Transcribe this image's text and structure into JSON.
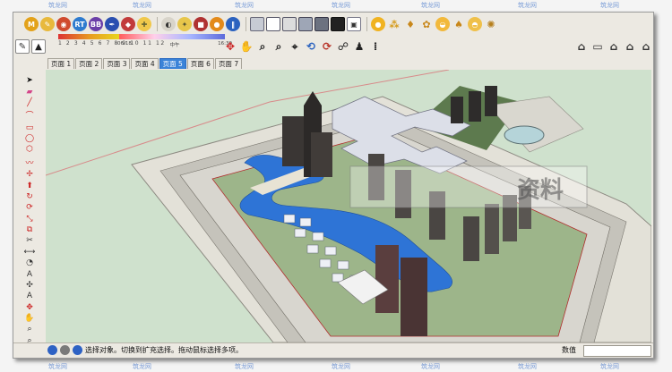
{
  "scene_tabs": [
    "页面 1",
    "页面 2",
    "页面 3",
    "页面 4",
    "页面 5",
    "页面 6",
    "页面 7"
  ],
  "active_tab_index": 4,
  "shadow_slider": {
    "ticks": "1 2 3 4 5 6 7 8 9 10 11 12",
    "time_start": "06:18",
    "time_mid": "中午",
    "time_end": "16:30"
  },
  "status": {
    "message": "选择对象。切换到扩充选择。拖动鼠标选择多项。",
    "measure_label": "数值",
    "measure_value": ""
  },
  "watermark": {
    "text": "筑龙网",
    "overlay_text": "资料"
  },
  "colors": {
    "accent": "#3b83d8",
    "ground": "#cfe1cd",
    "water": "#2e74d6",
    "toolbar_bg": "#ece9e2"
  },
  "toolbar_top_icons": [
    "get-models-icon",
    "share-model-icon",
    "layer-icon",
    "rt-icon",
    "bb-icon",
    "pen-icon",
    "dimension-icon",
    "protractor-icon",
    "section-icon",
    "axes-icon",
    "sandbox-icon",
    "follow-icon",
    "flip-icon",
    "cube-face-icon",
    "cube-wire-icon",
    "cube-shaded-icon",
    "cube-texture-icon",
    "cube-monochrome-icon",
    "cube-xray-icon",
    "shadow-sun-icon",
    "fog-icon",
    "edge-style-icon",
    "camera-position-icon",
    "walk-icon",
    "position-camera-icon",
    "look-around-icon"
  ],
  "toolbar_second_icons": [
    "select-tool-icon",
    "eraser-icon",
    "paint-bucket-icon",
    "orbit-icon",
    "pan-icon",
    "zoom-icon",
    "zoom-window-icon",
    "zoom-extents-icon",
    "previous-view-icon",
    "next-view-icon",
    "position-camera-icon",
    "walk-icon",
    "look-around-icon"
  ],
  "toolbar_right_icons": [
    "iso-view-icon",
    "top-view-icon",
    "front-view-icon",
    "right-view-icon",
    "back-view-icon",
    "left-view-icon"
  ],
  "left_toolbar_icons": [
    "select-icon",
    "eraser-icon",
    "line-icon",
    "arc-icon",
    "rectangle-icon",
    "circle-icon",
    "polygon-icon",
    "freehand-icon",
    "move-icon",
    "push-pull-icon",
    "rotate-icon",
    "follow-me-icon",
    "scale-icon",
    "offset-icon",
    "tape-measure-icon",
    "dimension-icon",
    "protractor-icon",
    "text-icon",
    "axes-icon",
    "3d-text-icon",
    "orbit-icon",
    "pan-icon",
    "zoom-icon",
    "zoom-window-icon",
    "zoom-extents-icon",
    "previous-view-icon"
  ]
}
